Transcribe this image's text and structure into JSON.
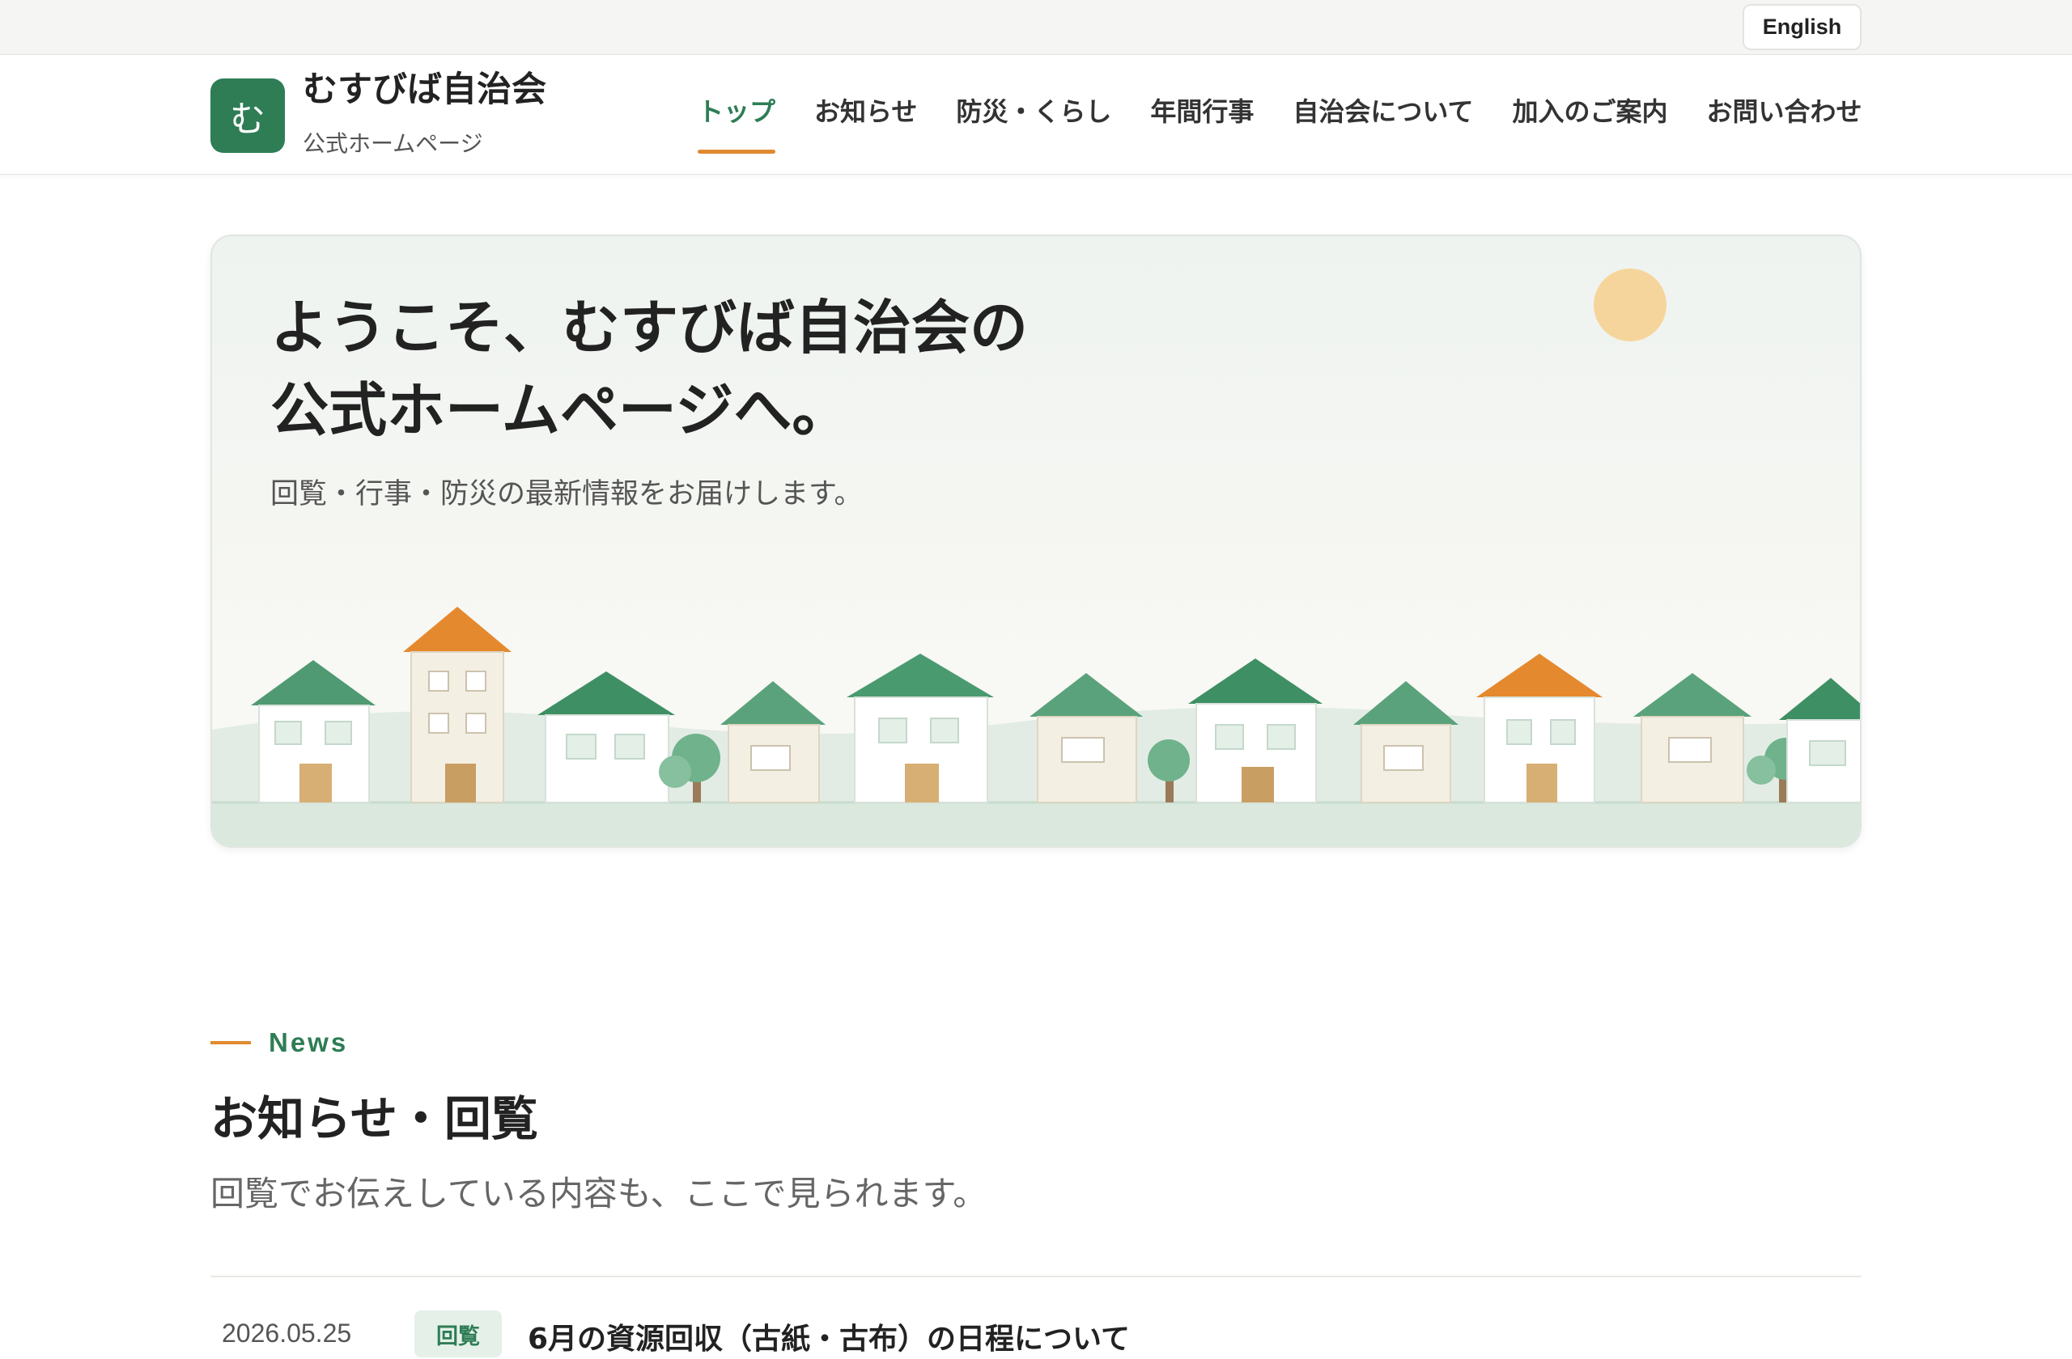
{
  "topbar": {
    "language_button": "English"
  },
  "header": {
    "logo_glyph": "む",
    "site_name": "むすびば自治会",
    "site_subtitle": "公式ホームページ",
    "nav": [
      {
        "label": "トップ",
        "active": true
      },
      {
        "label": "お知らせ",
        "active": false
      },
      {
        "label": "防災・くらし",
        "active": false
      },
      {
        "label": "年間行事",
        "active": false
      },
      {
        "label": "自治会について",
        "active": false
      },
      {
        "label": "加入のご案内",
        "active": false
      },
      {
        "label": "お問い合わせ",
        "active": false
      }
    ]
  },
  "hero": {
    "title_line1": "ようこそ、むすびば自治会の",
    "title_line2": "公式ホームページへ。",
    "subtitle": "回覧・行事・防災の最新情報をお届けします。"
  },
  "news": {
    "eyebrow": "News",
    "title": "お知らせ・回覧",
    "description": "回覧でお伝えしている内容も、ここで見られます。",
    "items": [
      {
        "date": "2026.05.25",
        "badge": "回覧",
        "headline": "6月の資源回収（古紙・古布）の日程について"
      }
    ]
  },
  "colors": {
    "brand_green": "#2e7d55",
    "accent_orange": "#e08a30",
    "sun": "#f6d59d",
    "roof_green": "#4a9a70",
    "roof_orange": "#e5892e"
  }
}
